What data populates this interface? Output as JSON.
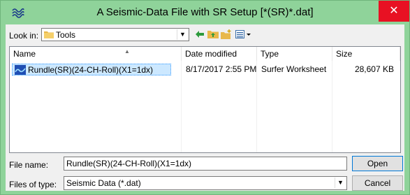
{
  "window": {
    "title": "A Seismic-Data File with SR Setup [*(SR)*.dat]",
    "close_glyph": "✕",
    "accent_color": "#8fd39a"
  },
  "lookin": {
    "label": "Look in:",
    "value": "Tools",
    "icon": "folder-icon"
  },
  "toolbar": {
    "icons": [
      "back-arrow-icon",
      "up-folder-icon",
      "new-folder-icon",
      "view-menu-icon"
    ]
  },
  "columns": {
    "name": "Name",
    "date": "Date modified",
    "type": "Type",
    "size": "Size"
  },
  "files": [
    {
      "name": "Rundle(SR)(24-CH-Roll)(X1=1dx)",
      "date": "8/17/2017 2:55 PM",
      "type": "Surfer Worksheet",
      "size": "28,607 KB",
      "selected": true
    }
  ],
  "filename": {
    "label": "File name:",
    "value": "Rundle(SR)(24-CH-Roll)(X1=1dx)"
  },
  "filetype": {
    "label": "Files of type:",
    "value": "Seismic Data (*.dat)"
  },
  "buttons": {
    "open": "Open",
    "cancel": "Cancel"
  }
}
